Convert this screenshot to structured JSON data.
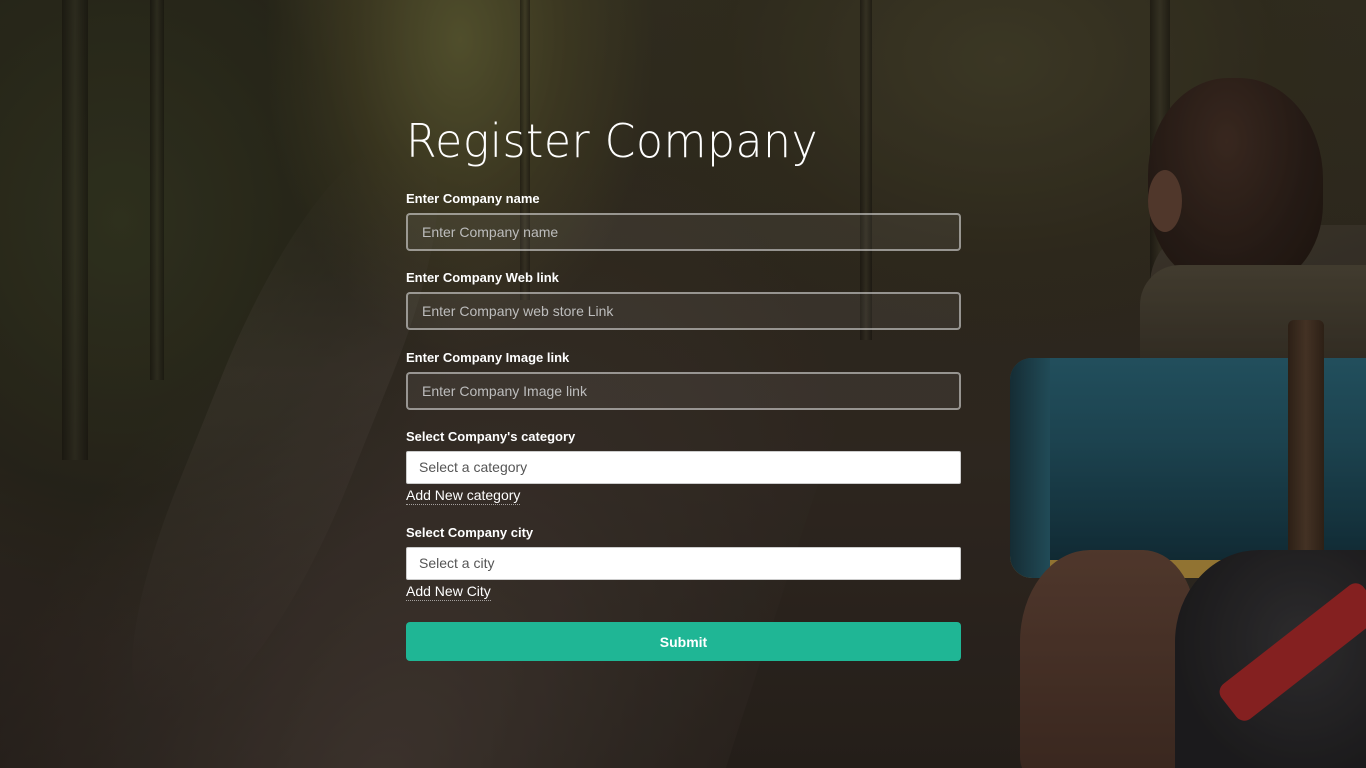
{
  "form": {
    "title": "Register Company",
    "company_name": {
      "label": "Enter Company name",
      "placeholder": "Enter Company name"
    },
    "web_link": {
      "label": "Enter Company Web link",
      "placeholder": "Enter Company web store Link"
    },
    "image_link": {
      "label": "Enter Company Image link",
      "placeholder": "Enter Company Image link"
    },
    "category": {
      "label": "Select Company's category",
      "selected": "Select a category",
      "add_link": "Add New category"
    },
    "city": {
      "label": "Select Company city",
      "selected": "Select a city",
      "add_link": "Add New City"
    },
    "submit_label": "Submit"
  },
  "colors": {
    "accent": "#1fb695",
    "text": "#ffffff"
  }
}
